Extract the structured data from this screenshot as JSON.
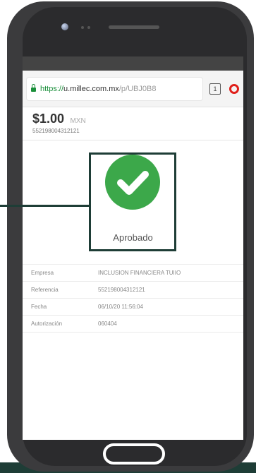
{
  "browser": {
    "url_scheme": "https://",
    "url_domain": "u.millec.com.mx",
    "url_path": "/p/UBJ0B8",
    "tab_count": "1"
  },
  "payment": {
    "amount": "$1.00",
    "currency": "MXN",
    "reference_small": "552198004312121"
  },
  "status": {
    "label": "Aprobado",
    "icon": "check-icon",
    "color": "#3ca84a"
  },
  "details": [
    {
      "label": "Empresa",
      "value": "INCLUSION FINANCIERA TUIIO"
    },
    {
      "label": "Referencia",
      "value": "552198004312121"
    },
    {
      "label": "Fecha",
      "value": "06/10/20 11:56:04"
    },
    {
      "label": "Autorización",
      "value": "060404"
    }
  ],
  "colors": {
    "accent": "#1e3d36",
    "success": "#3ca84a"
  }
}
